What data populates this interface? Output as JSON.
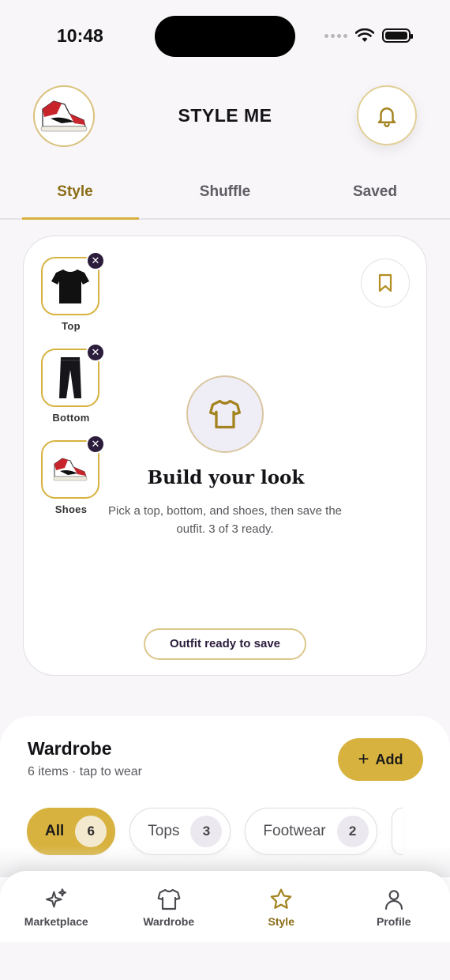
{
  "status": {
    "time": "10:48"
  },
  "header": {
    "title": "STYLE ME"
  },
  "tabs": [
    {
      "label": "Style",
      "active": true
    },
    {
      "label": "Shuffle",
      "active": false
    },
    {
      "label": "Saved",
      "active": false
    }
  ],
  "builder": {
    "slots": [
      {
        "label": "Top",
        "icon": "tshirt-image"
      },
      {
        "label": "Bottom",
        "icon": "pants-image"
      },
      {
        "label": "Shoes",
        "icon": "sneaker-image"
      }
    ],
    "title": "Build your look",
    "description": "Pick a top, bottom, and shoes, then save the outfit. 3 of 3 ready.",
    "status_pill": "Outfit ready to save"
  },
  "wardrobe": {
    "title": "Wardrobe",
    "subtitle": "6 items · tap to wear",
    "add_label": "Add",
    "chips": [
      {
        "label": "All",
        "count": "6",
        "active": true
      },
      {
        "label": "Tops",
        "count": "3",
        "active": false
      },
      {
        "label": "Footwear",
        "count": "2",
        "active": false
      }
    ]
  },
  "nav": [
    {
      "label": "Marketplace",
      "icon": "sparkles-icon",
      "active": false
    },
    {
      "label": "Wardrobe",
      "icon": "shirt-icon",
      "active": false
    },
    {
      "label": "Style",
      "icon": "star-icon",
      "active": true
    },
    {
      "label": "Profile",
      "icon": "person-icon",
      "active": false
    }
  ],
  "colors": {
    "accent": "#d7b23f",
    "accent_text": "#8b6d17",
    "dark": "#2c1d3d"
  }
}
